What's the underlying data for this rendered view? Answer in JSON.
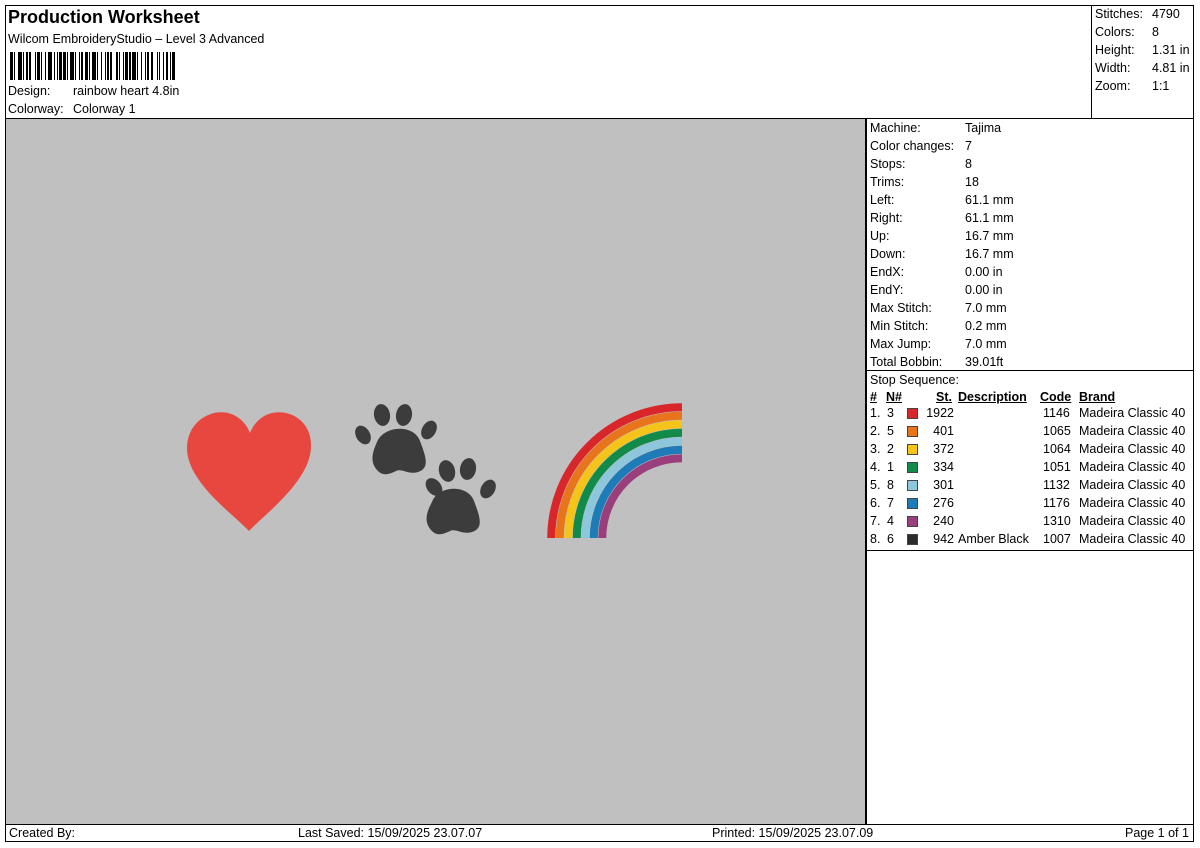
{
  "header": {
    "title": "Production Worksheet",
    "software": "Wilcom EmbroideryStudio – Level 3 Advanced",
    "design_label": "Design:",
    "design_value": "rainbow heart 4.8in",
    "colorway_label": "Colorway:",
    "colorway_value": "Colorway 1"
  },
  "summary": [
    {
      "label": "Stitches:",
      "value": "4790"
    },
    {
      "label": "Colors:",
      "value": "8"
    },
    {
      "label": "Height:",
      "value": "1.31 in"
    },
    {
      "label": "Width:",
      "value": "4.81 in"
    },
    {
      "label": "Zoom:",
      "value": "1:1"
    }
  ],
  "stats": [
    {
      "label": "Machine:",
      "value": "Tajima"
    },
    {
      "label": "Color changes:",
      "value": "7"
    },
    {
      "label": "Stops:",
      "value": "8"
    },
    {
      "label": "Trims:",
      "value": "18"
    },
    {
      "label": "Left:",
      "value": "61.1 mm"
    },
    {
      "label": "Right:",
      "value": "61.1 mm"
    },
    {
      "label": "Up:",
      "value": "16.7 mm"
    },
    {
      "label": "Down:",
      "value": "16.7 mm"
    },
    {
      "label": "EndX:",
      "value": "0.00 in"
    },
    {
      "label": "EndY:",
      "value": "0.00 in"
    },
    {
      "label": "Max Stitch:",
      "value": "7.0 mm"
    },
    {
      "label": "Min Stitch:",
      "value": "0.2 mm"
    },
    {
      "label": "Max Jump:",
      "value": "7.0 mm"
    },
    {
      "label": "Total Bobbin:",
      "value": "39.01ft"
    }
  ],
  "stop_sequence": {
    "title": "Stop Sequence:",
    "headers": {
      "num": "#",
      "n": "N#",
      "st": "St.",
      "description": "Description",
      "code": "Code",
      "brand": "Brand"
    },
    "rows": [
      {
        "num": "1.",
        "n": "3",
        "color": "#d8262a",
        "st": "1922",
        "description": "",
        "code": "1146",
        "brand": "Madeira Classic 40"
      },
      {
        "num": "2.",
        "n": "5",
        "color": "#e8741c",
        "st": "401",
        "description": "",
        "code": "1065",
        "brand": "Madeira Classic 40"
      },
      {
        "num": "3.",
        "n": "2",
        "color": "#f5c41a",
        "st": "372",
        "description": "",
        "code": "1064",
        "brand": "Madeira Classic 40"
      },
      {
        "num": "4.",
        "n": "1",
        "color": "#128a4a",
        "st": "334",
        "description": "",
        "code": "1051",
        "brand": "Madeira Classic 40"
      },
      {
        "num": "5.",
        "n": "8",
        "color": "#8ec6dc",
        "st": "301",
        "description": "",
        "code": "1132",
        "brand": "Madeira Classic 40"
      },
      {
        "num": "6.",
        "n": "7",
        "color": "#1d7bb8",
        "st": "276",
        "description": "",
        "code": "1176",
        "brand": "Madeira Classic 40"
      },
      {
        "num": "7.",
        "n": "4",
        "color": "#9a3f7c",
        "st": "240",
        "description": "",
        "code": "1310",
        "brand": "Madeira Classic 40"
      },
      {
        "num": "8.",
        "n": "6",
        "color": "#2b2b2b",
        "st": "942",
        "description": "Amber Black",
        "code": "1007",
        "brand": "Madeira Classic 40"
      }
    ]
  },
  "design_colors": {
    "heart": "#e8473f",
    "paw": "#3c3c3c",
    "rainbow": [
      "#d8262a",
      "#e8741c",
      "#f5c41a",
      "#128a4a",
      "#8ec6dc",
      "#1d7bb8",
      "#9a3f7c"
    ]
  },
  "footer": {
    "created_by": "Created By:",
    "last_saved": "Last Saved: 15/09/2025 23.07.07",
    "printed": "Printed: 15/09/2025 23.07.09",
    "page": "Page 1 of 1"
  }
}
